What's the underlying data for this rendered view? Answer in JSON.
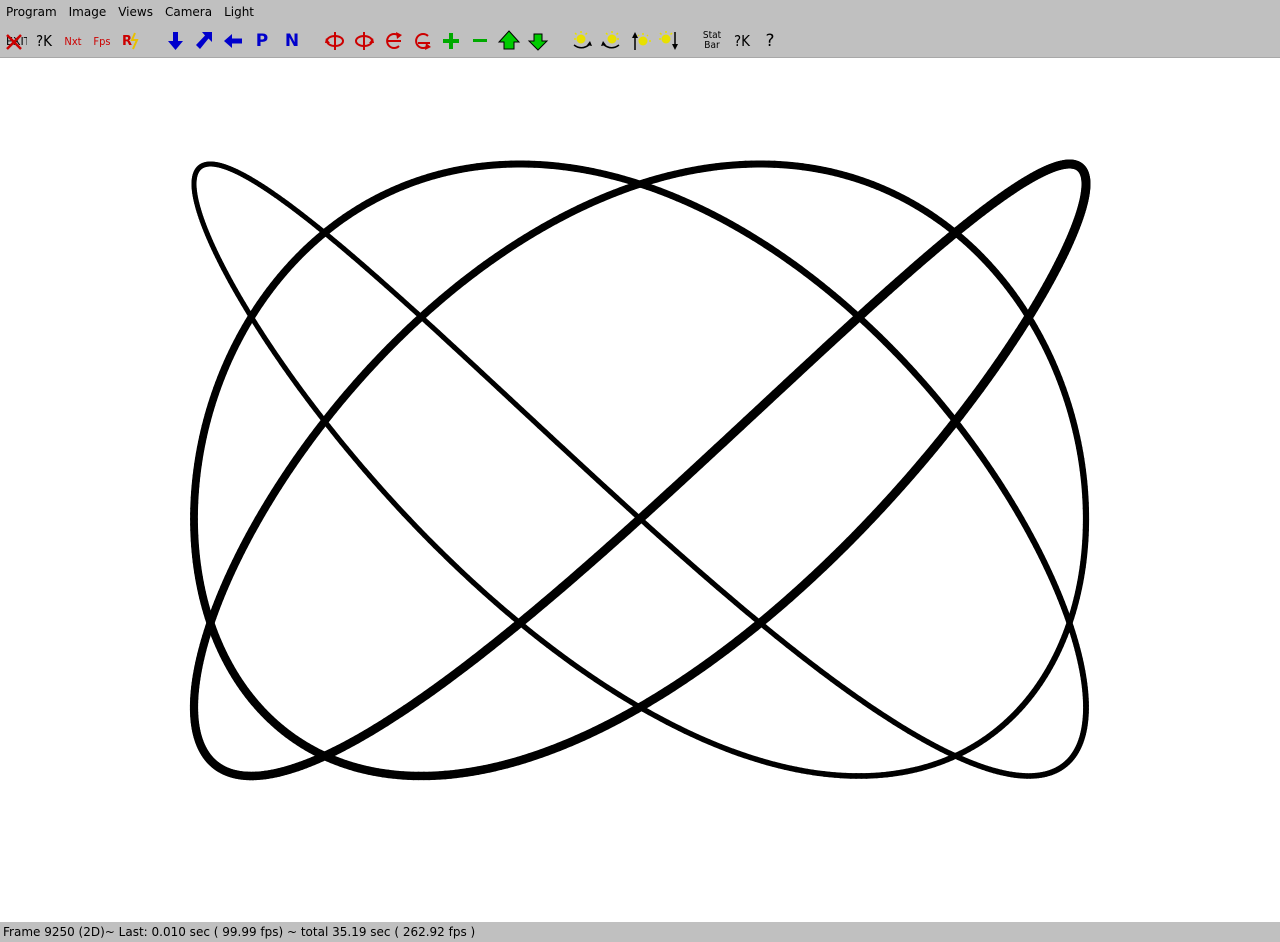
{
  "menubar": {
    "items": [
      "Program",
      "Image",
      "Views",
      "Camera",
      "Light"
    ]
  },
  "toolbar": {
    "exit_label": "EXIT",
    "ok_label": "?K",
    "next_label": "Nxt",
    "fps_label": "Fps",
    "reset_label": "R",
    "p_label": "P",
    "n_label": "N",
    "stat_label_top": "Stat",
    "stat_label_bottom": "Bar",
    "ok2_label": "?K",
    "help_label": "?",
    "icons": [
      "exit-icon",
      "ok-query-icon",
      "next-icon",
      "fps-icon",
      "reset-icon",
      "arrow-down-icon",
      "arrow-diagonal-icon",
      "arrow-left-icon",
      "p-icon",
      "n-icon",
      "rotate-y-left-icon",
      "rotate-y-right-icon",
      "rotate-z-left-icon",
      "rotate-z-right-icon",
      "zoom-in-icon",
      "zoom-out-icon",
      "move-up-icon",
      "move-down-icon",
      "light-rotate-left-icon",
      "light-rotate-right-icon",
      "light-up-icon",
      "light-down-icon",
      "stat-bar-icon",
      "ok-query-icon",
      "help-icon"
    ]
  },
  "colors": {
    "chrome": "#c0c0c0",
    "red": "#cc0000",
    "blue": "#0000cc",
    "green": "#00aa00",
    "yellow": "#e8e000",
    "curve": "#000000"
  },
  "status": {
    "text": "Frame 9250 (2D)~ Last: 0.010 sec ( 99.99 fps) ~ total 35.19 sec ( 262.92 fps )"
  }
}
